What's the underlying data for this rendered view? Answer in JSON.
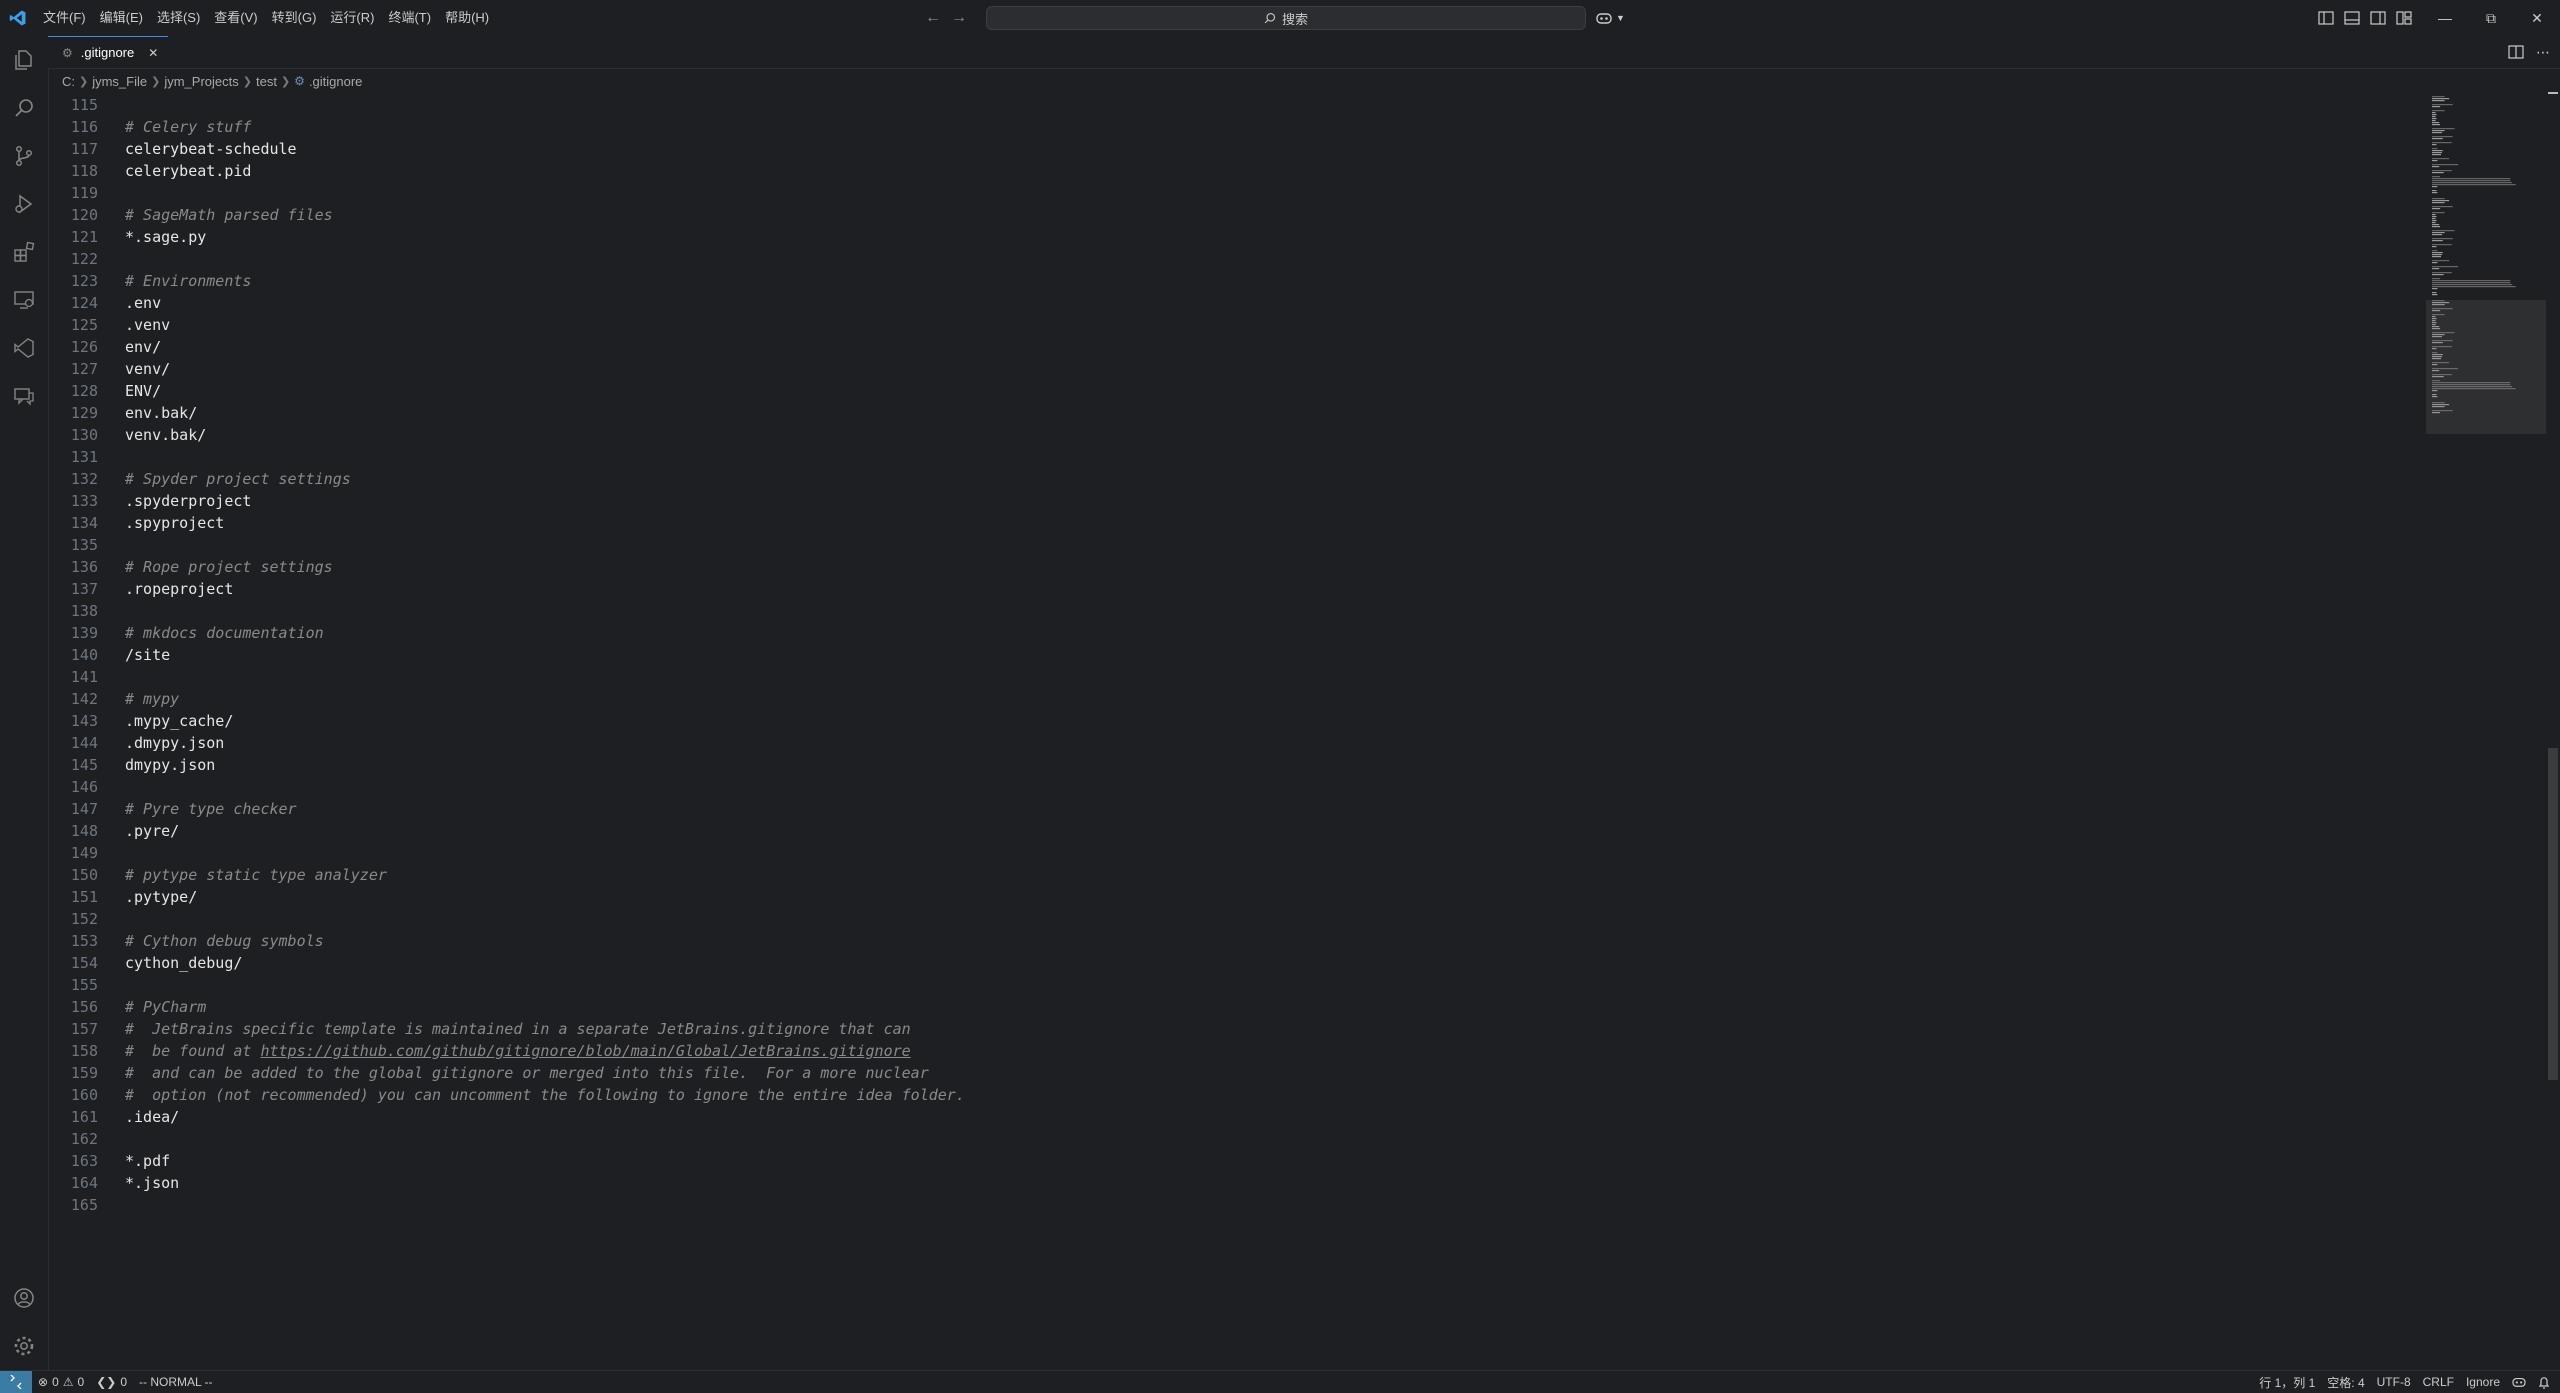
{
  "menu": [
    "文件(F)",
    "编辑(E)",
    "选择(S)",
    "查看(V)",
    "转到(G)",
    "运行(R)",
    "终端(T)",
    "帮助(H)"
  ],
  "search": {
    "label": "搜索"
  },
  "tab": {
    "filename": ".gitignore"
  },
  "breadcrumb": [
    "C:",
    "jyms_File",
    "jym_Projects",
    "test",
    ".gitignore"
  ],
  "editor": {
    "lines": [
      {
        "n": "115",
        "t": "",
        "c": false
      },
      {
        "n": "116",
        "t": "# Celery stuff",
        "c": true
      },
      {
        "n": "117",
        "t": "celerybeat-schedule",
        "c": false
      },
      {
        "n": "118",
        "t": "celerybeat.pid",
        "c": false
      },
      {
        "n": "119",
        "t": "",
        "c": false
      },
      {
        "n": "120",
        "t": "# SageMath parsed files",
        "c": true
      },
      {
        "n": "121",
        "t": "*.sage.py",
        "c": false
      },
      {
        "n": "122",
        "t": "",
        "c": false
      },
      {
        "n": "123",
        "t": "# Environments",
        "c": true
      },
      {
        "n": "124",
        "t": ".env",
        "c": false
      },
      {
        "n": "125",
        "t": ".venv",
        "c": false
      },
      {
        "n": "126",
        "t": "env/",
        "c": false
      },
      {
        "n": "127",
        "t": "venv/",
        "c": false
      },
      {
        "n": "128",
        "t": "ENV/",
        "c": false
      },
      {
        "n": "129",
        "t": "env.bak/",
        "c": false
      },
      {
        "n": "130",
        "t": "venv.bak/",
        "c": false
      },
      {
        "n": "131",
        "t": "",
        "c": false
      },
      {
        "n": "132",
        "t": "# Spyder project settings",
        "c": true
      },
      {
        "n": "133",
        "t": ".spyderproject",
        "c": false
      },
      {
        "n": "134",
        "t": ".spyproject",
        "c": false
      },
      {
        "n": "135",
        "t": "",
        "c": false
      },
      {
        "n": "136",
        "t": "# Rope project settings",
        "c": true
      },
      {
        "n": "137",
        "t": ".ropeproject",
        "c": false
      },
      {
        "n": "138",
        "t": "",
        "c": false
      },
      {
        "n": "139",
        "t": "# mkdocs documentation",
        "c": true
      },
      {
        "n": "140",
        "t": "/site",
        "c": false
      },
      {
        "n": "141",
        "t": "",
        "c": false
      },
      {
        "n": "142",
        "t": "# mypy",
        "c": true
      },
      {
        "n": "143",
        "t": ".mypy_cache/",
        "c": false
      },
      {
        "n": "144",
        "t": ".dmypy.json",
        "c": false
      },
      {
        "n": "145",
        "t": "dmypy.json",
        "c": false
      },
      {
        "n": "146",
        "t": "",
        "c": false
      },
      {
        "n": "147",
        "t": "# Pyre type checker",
        "c": true
      },
      {
        "n": "148",
        "t": ".pyre/",
        "c": false
      },
      {
        "n": "149",
        "t": "",
        "c": false
      },
      {
        "n": "150",
        "t": "# pytype static type analyzer",
        "c": true
      },
      {
        "n": "151",
        "t": ".pytype/",
        "c": false
      },
      {
        "n": "152",
        "t": "",
        "c": false
      },
      {
        "n": "153",
        "t": "# Cython debug symbols",
        "c": true
      },
      {
        "n": "154",
        "t": "cython_debug/",
        "c": false
      },
      {
        "n": "155",
        "t": "",
        "c": false
      },
      {
        "n": "156",
        "t": "# PyCharm",
        "c": true
      },
      {
        "n": "157",
        "t": "#  JetBrains specific template is maintained in a separate JetBrains.gitignore that can",
        "c": true
      },
      {
        "n": "158",
        "t": "#  be found at ",
        "c": true,
        "link": "https://github.com/github/gitignore/blob/main/Global/JetBrains.gitignore"
      },
      {
        "n": "159",
        "t": "#  and can be added to the global gitignore or merged into this file.  For a more nuclear",
        "c": true
      },
      {
        "n": "160",
        "t": "#  option (not recommended) you can uncomment the following to ignore the entire idea folder.",
        "c": true
      },
      {
        "n": "161",
        "t": ".idea/",
        "c": false
      },
      {
        "n": "162",
        "t": "",
        "c": false
      },
      {
        "n": "163",
        "t": "*.pdf",
        "c": false
      },
      {
        "n": "164",
        "t": "*.json",
        "c": false
      },
      {
        "n": "165",
        "t": "",
        "c": false
      }
    ]
  },
  "status": {
    "errors": "0",
    "warnings": "0",
    "ports": "0",
    "vim_mode": "-- NORMAL --",
    "position": "行 1，列 1",
    "indent": "空格: 4",
    "encoding": "UTF-8",
    "eol": "CRLF",
    "language": "Ignore"
  },
  "colors": {
    "accent": "#4a88e0",
    "remote": "#3a7ca5",
    "background": "#1e1f22"
  }
}
